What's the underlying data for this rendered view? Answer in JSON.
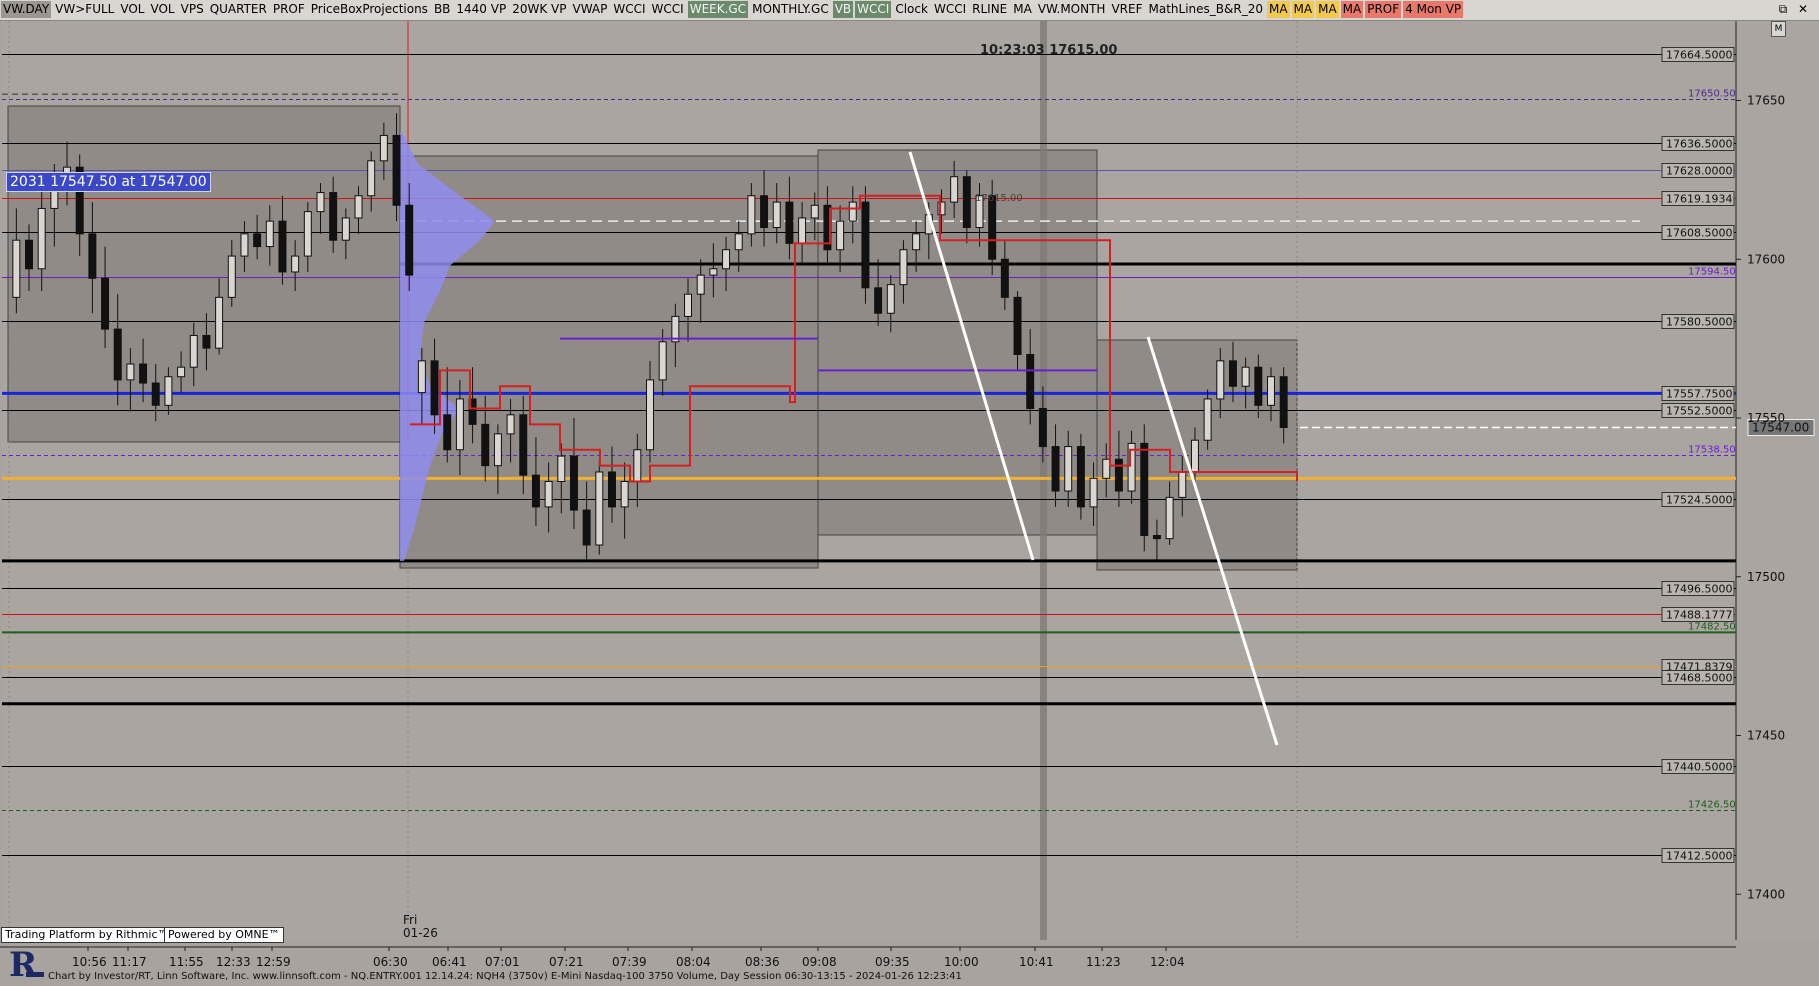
{
  "toolbar": {
    "buttons": [
      {
        "label": "VW.DAY",
        "style": "sel"
      },
      {
        "label": "VW>FULL",
        "style": ""
      },
      {
        "label": "VOL",
        "style": ""
      },
      {
        "label": "VOL",
        "style": ""
      },
      {
        "label": "VPS",
        "style": ""
      },
      {
        "label": "QUARTER",
        "style": ""
      },
      {
        "label": "PROF",
        "style": ""
      },
      {
        "label": "PriceBoxProjections",
        "style": ""
      },
      {
        "label": "BB",
        "style": ""
      },
      {
        "label": "1440 VP",
        "style": ""
      },
      {
        "label": "20WK VP",
        "style": ""
      },
      {
        "label": "VWAP",
        "style": ""
      },
      {
        "label": "WCCI",
        "style": ""
      },
      {
        "label": "WCCI",
        "style": ""
      },
      {
        "label": "WEEK.GC",
        "style": "wk"
      },
      {
        "label": "MONTHLY.GC",
        "style": ""
      },
      {
        "label": "VB",
        "style": "wk"
      },
      {
        "label": "WCCI",
        "style": "wk"
      },
      {
        "label": "Clock",
        "style": ""
      },
      {
        "label": "WCCI",
        "style": ""
      },
      {
        "label": "RLINE",
        "style": ""
      },
      {
        "label": "MA",
        "style": ""
      },
      {
        "label": "VW.MONTH",
        "style": ""
      },
      {
        "label": "VREF",
        "style": ""
      },
      {
        "label": "MathLines_B&R_20",
        "style": ""
      },
      {
        "label": "MA",
        "style": "y"
      },
      {
        "label": "MA",
        "style": "y"
      },
      {
        "label": "MA",
        "style": "y"
      },
      {
        "label": "MA",
        "style": "r"
      },
      {
        "label": "PROF",
        "style": "r"
      },
      {
        "label": "4 Mon VP",
        "style": "r"
      }
    ],
    "window_buttons": [
      "⧉",
      "✕"
    ],
    "m_button": "M"
  },
  "overlay": {
    "clock_text": "10:23:03  17615.00",
    "price_tag": "2031 17547.50 at 17547.00",
    "date_label_day": "Fri",
    "date_label_date": "01-26",
    "mid_label": "17615.00",
    "current_price": "17547.00",
    "badge_rithmic": "Trading Platform by Rithmic™",
    "badge_omne": "Powered by OMNE™",
    "footer": "Chart by Investor/RT, Linn Software, Inc. www.linnsoft.com - NQ.ENTRY.001   12.14.24: NQH4 (3750v) E-Mini Nasdaq-100 3750 Volume, Day Session 06:30-13:15 - 2024-01-26 12:23:41"
  },
  "chart_data": {
    "type": "candlestick",
    "instrument": "NQH4 E-Mini Nasdaq-100 3750 Volume",
    "y_axis": {
      "min": 17390,
      "max": 17670,
      "ticks": [
        17650,
        17600,
        17550,
        17500,
        17450,
        17400
      ]
    },
    "x_ticks": [
      "10:56",
      "11:17",
      "11:55",
      "12:33",
      "12:59",
      "06:30",
      "06:41",
      "07:01",
      "07:21",
      "07:39",
      "08:04",
      "08:36",
      "09:08",
      "09:35",
      "10:00",
      "10:41",
      "11:23",
      "12:04"
    ],
    "levels": [
      {
        "label": "17664.5000",
        "value": 17664.5,
        "color": "#000000",
        "dash": false
      },
      {
        "label": "17650.50",
        "value": 17650.5,
        "color": "#4a2a8a",
        "dash": true
      },
      {
        "label": "17636.5000",
        "value": 17636.5,
        "color": "#000000",
        "dash": false
      },
      {
        "label": "17628.0000",
        "value": 17628.0,
        "color": "#5a55a8",
        "dash": false
      },
      {
        "label": "17619.1934",
        "value": 17619.1934,
        "color": "#cc1111",
        "dash": false
      },
      {
        "label": "17608.5000",
        "value": 17608.5,
        "color": "#000000",
        "dash": false
      },
      {
        "label": "17594.50",
        "value": 17594.5,
        "color": "#6a1fc8",
        "dash": false
      },
      {
        "label": "17580.5000",
        "value": 17580.5,
        "color": "#000000",
        "dash": false
      },
      {
        "label": "17557.7500",
        "value": 17557.75,
        "color": "#1a24d8",
        "dash": false
      },
      {
        "label": "17552.5000",
        "value": 17552.5,
        "color": "#000000",
        "dash": false
      },
      {
        "label": "17538.50",
        "value": 17538.5,
        "color": "#6a1fc8",
        "dash": true
      },
      {
        "label": "17524.5000",
        "value": 17524.5,
        "color": "#000000",
        "dash": false
      },
      {
        "label": "17496.5000",
        "value": 17496.5,
        "color": "#000000",
        "dash": false
      },
      {
        "label": "17488.1777",
        "value": 17488.1777,
        "color": "#cc1111",
        "dash": false
      },
      {
        "label": "17482.50",
        "value": 17482.5,
        "color": "#1e5e1e",
        "dash": false
      },
      {
        "label": "17471.8379",
        "value": 17471.8379,
        "color": "#f0a020",
        "dash": false
      },
      {
        "label": "17468.5000",
        "value": 17468.5,
        "color": "#000000",
        "dash": false
      },
      {
        "label": "17440.5000",
        "value": 17440.5,
        "color": "#000000",
        "dash": false
      },
      {
        "label": "17426.50",
        "value": 17426.5,
        "color": "#1e5e1e",
        "dash": true
      },
      {
        "label": "17412.5000",
        "value": 17412.5,
        "color": "#000000",
        "dash": false
      }
    ],
    "current_price": 17547.0,
    "candles": [
      [
        17588,
        17616,
        17583,
        17606
      ],
      [
        17606,
        17611,
        17590,
        17597
      ],
      [
        17597,
        17627,
        17590,
        17616
      ],
      [
        17616,
        17630,
        17604,
        17623
      ],
      [
        17623,
        17637,
        17617,
        17629
      ],
      [
        17629,
        17633,
        17601,
        17608
      ],
      [
        17608,
        17618,
        17583,
        17594
      ],
      [
        17594,
        17604,
        17572,
        17578
      ],
      [
        17578,
        17589,
        17554,
        17562
      ],
      [
        17562,
        17572,
        17552,
        17567
      ],
      [
        17567,
        17575,
        17555,
        17561
      ],
      [
        17561,
        17567,
        17549,
        17554
      ],
      [
        17554,
        17566,
        17551,
        17563
      ],
      [
        17563,
        17571,
        17558,
        17566
      ],
      [
        17566,
        17580,
        17560,
        17576
      ],
      [
        17576,
        17583,
        17565,
        17572
      ],
      [
        17572,
        17594,
        17570,
        17588
      ],
      [
        17588,
        17606,
        17585,
        17601
      ],
      [
        17601,
        17612,
        17596,
        17608
      ],
      [
        17608,
        17614,
        17600,
        17604
      ],
      [
        17604,
        17617,
        17598,
        17612
      ],
      [
        17612,
        17620,
        17592,
        17596
      ],
      [
        17596,
        17606,
        17590,
        17601
      ],
      [
        17601,
        17618,
        17596,
        17615
      ],
      [
        17615,
        17624,
        17608,
        17621
      ],
      [
        17621,
        17626,
        17602,
        17606
      ],
      [
        17606,
        17616,
        17600,
        17613
      ],
      [
        17613,
        17623,
        17608,
        17620
      ],
      [
        17620,
        17634,
        17615,
        17631
      ],
      [
        17631,
        17643,
        17625,
        17639
      ],
      [
        17639,
        17646,
        17612,
        17617
      ],
      [
        17617,
        17624,
        17590,
        17595
      ],
      [
        17558,
        17572,
        17548,
        17568
      ],
      [
        17568,
        17575,
        17545,
        17551
      ],
      [
        17551,
        17566,
        17536,
        17540
      ],
      [
        17540,
        17562,
        17532,
        17556
      ],
      [
        17556,
        17566,
        17542,
        17548
      ],
      [
        17548,
        17557,
        17530,
        17535
      ],
      [
        17535,
        17548,
        17526,
        17545
      ],
      [
        17545,
        17556,
        17536,
        17551
      ],
      [
        17551,
        17557,
        17526,
        17532
      ],
      [
        17532,
        17544,
        17516,
        17522
      ],
      [
        17522,
        17536,
        17514,
        17530
      ],
      [
        17530,
        17542,
        17520,
        17538
      ],
      [
        17538,
        17550,
        17515,
        17521
      ],
      [
        17521,
        17530,
        17505,
        17510
      ],
      [
        17510,
        17537,
        17507,
        17533
      ],
      [
        17533,
        17541,
        17517,
        17522
      ],
      [
        17522,
        17536,
        17512,
        17530
      ],
      [
        17530,
        17545,
        17522,
        17540
      ],
      [
        17540,
        17568,
        17536,
        17562
      ],
      [
        17562,
        17578,
        17557,
        17574
      ],
      [
        17574,
        17586,
        17566,
        17582
      ],
      [
        17582,
        17594,
        17574,
        17589
      ],
      [
        17589,
        17600,
        17580,
        17595
      ],
      [
        17595,
        17605,
        17588,
        17597
      ],
      [
        17597,
        17607,
        17590,
        17603
      ],
      [
        17603,
        17612,
        17596,
        17608
      ],
      [
        17608,
        17624,
        17604,
        17620
      ],
      [
        17620,
        17628,
        17604,
        17610
      ],
      [
        17610,
        17624,
        17605,
        17618
      ],
      [
        17618,
        17626,
        17600,
        17605
      ],
      [
        17605,
        17618,
        17598,
        17613
      ],
      [
        17613,
        17621,
        17606,
        17617
      ],
      [
        17617,
        17623,
        17598,
        17603
      ],
      [
        17603,
        17617,
        17596,
        17612
      ],
      [
        17612,
        17623,
        17605,
        17618
      ],
      [
        17618,
        17623,
        17586,
        17591
      ],
      [
        17591,
        17600,
        17579,
        17583
      ],
      [
        17583,
        17595,
        17577,
        17592
      ],
      [
        17592,
        17606,
        17586,
        17603
      ],
      [
        17603,
        17612,
        17596,
        17608
      ],
      [
        17608,
        17618,
        17600,
        17614
      ],
      [
        17614,
        17622,
        17608,
        17618
      ],
      [
        17618,
        17631,
        17613,
        17626
      ],
      [
        17626,
        17628,
        17605,
        17610
      ],
      [
        17610,
        17624,
        17604,
        17620
      ],
      [
        17620,
        17625,
        17595,
        17600
      ],
      [
        17600,
        17606,
        17584,
        17588
      ],
      [
        17588,
        17590,
        17565,
        17570
      ],
      [
        17570,
        17578,
        17548,
        17553
      ],
      [
        17553,
        17560,
        17536,
        17541
      ],
      [
        17541,
        17548,
        17522,
        17527
      ],
      [
        17527,
        17546,
        17522,
        17541
      ],
      [
        17541,
        17545,
        17518,
        17522
      ],
      [
        17522,
        17536,
        17516,
        17531
      ],
      [
        17531,
        17542,
        17525,
        17537
      ],
      [
        17537,
        17546,
        17522,
        17527
      ],
      [
        17527,
        17546,
        17523,
        17542
      ],
      [
        17542,
        17548,
        17508,
        17513
      ],
      [
        17513,
        17518,
        17505,
        17512
      ],
      [
        17512,
        17530,
        17510,
        17525
      ],
      [
        17525,
        17538,
        17519,
        17533
      ],
      [
        17533,
        17547,
        17528,
        17543
      ],
      [
        17543,
        17559,
        17540,
        17556
      ],
      [
        17556,
        17572,
        17550,
        17568
      ],
      [
        17568,
        17574,
        17555,
        17560
      ],
      [
        17560,
        17569,
        17553,
        17566
      ],
      [
        17566,
        17570,
        17550,
        17554
      ],
      [
        17554,
        17566,
        17549,
        17563
      ],
      [
        17563,
        17566,
        17542,
        17547
      ]
    ]
  }
}
